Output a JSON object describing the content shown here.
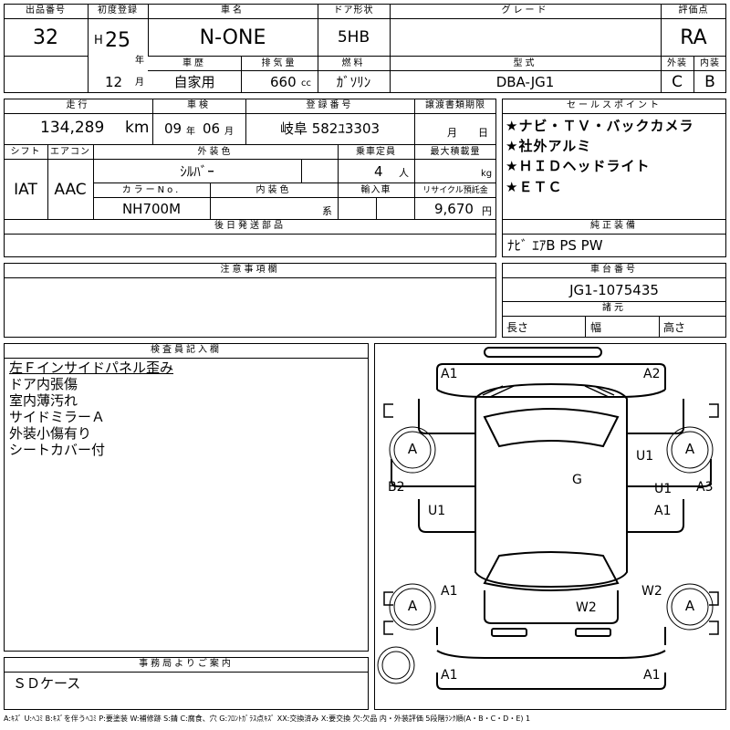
{
  "header": {
    "lot_label": "出品番号",
    "lot_no": "32",
    "first_reg_label": "初度登録",
    "era": "H",
    "year": "25",
    "year_unit": "年",
    "month": "12",
    "month_unit": "月",
    "car_name_label": "車名",
    "car_name": "N-ONE",
    "door_label": "ドア形状",
    "door": "5HB",
    "grade_label": "グレード",
    "grade": "",
    "score_label": "評価点",
    "score": "RA",
    "history_label": "車歴",
    "history": "自家用",
    "displacement_label": "排気量",
    "displacement": "660",
    "displacement_unit": "cc",
    "fuel_label": "燃料",
    "fuel": "ｶﾞｿﾘﾝ",
    "model_label": "型式",
    "model": "DBA-JG1",
    "ext_label": "外装",
    "ext": "C",
    "int_label": "内装",
    "int": "B"
  },
  "row2": {
    "mileage_label": "走行",
    "mileage": "134,289",
    "mileage_unit": "km",
    "inspection_label": "車検",
    "insp_year": "09",
    "insp_year_unit": "年",
    "insp_month": "06",
    "insp_month_unit": "月",
    "plate_label": "登録番号",
    "plate": "岐阜 582ﾕ3303",
    "transfer_label": "譲渡書類期限",
    "transfer_month_unit": "月",
    "transfer_day_unit": "日",
    "shift_label": "シフト",
    "shift": "IAT",
    "ac_label": "エアコン",
    "ac": "AAC",
    "ext_color_label": "外装色",
    "ext_color": "ｼﾙﾊﾞｰ",
    "seating_label": "乗車定員",
    "seating": "4",
    "seating_unit": "人",
    "load_label": "最大積載量",
    "load_unit": "kg",
    "color_no_label": "カラーNo.",
    "color_no": "NH700M",
    "int_color_label": "内装色",
    "int_color_unit": "系",
    "import_label": "輸入車",
    "recycle_label": "リサイクル預託金",
    "recycle": "9,670",
    "recycle_unit": "円",
    "later_parts_label": "後日発送部品"
  },
  "sales": {
    "label": "セールスポイント",
    "points": [
      "★ナビ・ＴＶ・バックカメラ",
      "★社外アルミ",
      "★ＨＩＤヘッドライト",
      "★ＥＴＣ"
    ]
  },
  "genuine": {
    "label": "純正装備",
    "text": "ﾅﾋﾞ ｴｱB PS PW"
  },
  "notes": {
    "label": "注意事項欄"
  },
  "chassis": {
    "label": "車台番号",
    "value": "JG1-1075435",
    "spec_label": "諸元",
    "length": "長さ",
    "width": "幅",
    "height": "高さ"
  },
  "inspector": {
    "label": "検査員記入欄",
    "lines": [
      "左Ｆインサイドパネル歪み",
      "ドア内張傷",
      "室内薄汚れ",
      "サイドミラーＡ",
      "外装小傷有り",
      "シートカバー付"
    ]
  },
  "office": {
    "label": "事務局よりご案内",
    "text": "ＳＤケース"
  },
  "diagram": {
    "wheel_codes": [
      "A",
      "A",
      "A",
      "A"
    ],
    "codes": {
      "fl": "A1",
      "fr": "A2",
      "b2": "B2",
      "a3": "A3",
      "u1a": "U1",
      "u1b": "U1",
      "u1c": "U1",
      "a1r": "A1",
      "g": "G",
      "a1bl": "A1",
      "w2r": "W2",
      "w2": "W2",
      "a1rl": "A1",
      "a1rr": "A1"
    }
  },
  "legend": "A:ｷｽﾞ U:ﾍｺﾐ B:ｷｽﾞを伴うﾍｺﾐ P:要塗装 W:補修跡 S:錆 C:腐食、穴 G:ﾌﾛﾝﾄｶﾞﾗｽ点ｷｽﾞ XX:交換済み X:要交換 欠:欠品 内・外装評価 5段階ﾗﾝｸ順(A・B・C・D・E) 1"
}
